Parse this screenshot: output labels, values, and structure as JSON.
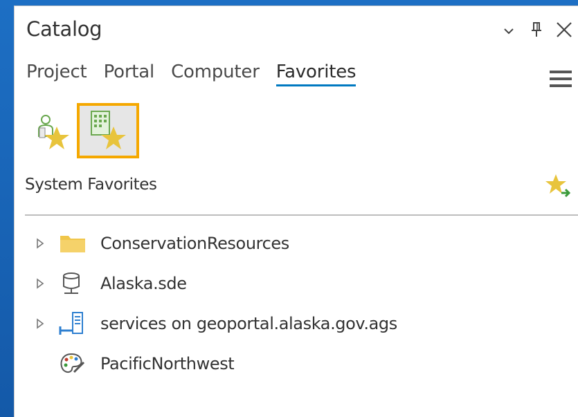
{
  "pane": {
    "title": "Catalog"
  },
  "window_controls": {
    "options_icon": "chevron-down-icon",
    "pin_icon": "pin-icon",
    "close_icon": "close-icon"
  },
  "tabs": [
    {
      "label": "Project",
      "active": false
    },
    {
      "label": "Portal",
      "active": false
    },
    {
      "label": "Computer",
      "active": false
    },
    {
      "label": "Favorites",
      "active": true
    }
  ],
  "menu_icon": "hamburger-menu-icon",
  "favorites_toolbar": [
    {
      "icon": "personal-favorites-star-icon",
      "selected": false
    },
    {
      "icon": "system-favorites-star-icon",
      "selected": true
    }
  ],
  "section": {
    "label": "System Favorites",
    "action_icon": "add-to-project-star-icon"
  },
  "items": [
    {
      "label": "ConservationResources",
      "icon": "folder-icon",
      "expandable": true
    },
    {
      "label": "Alaska.sde",
      "icon": "database-connection-icon",
      "expandable": true
    },
    {
      "label": "services on geoportal.alaska.gov.ags",
      "icon": "server-connection-icon",
      "expandable": true
    },
    {
      "label": "PacificNorthwest",
      "icon": "style-palette-icon",
      "expandable": false
    }
  ],
  "colors": {
    "accent": "#0079c1",
    "selected_border": "#f5a800",
    "star": "#e8c43c",
    "folder": "#f0c64a",
    "background": "#1762b4"
  }
}
